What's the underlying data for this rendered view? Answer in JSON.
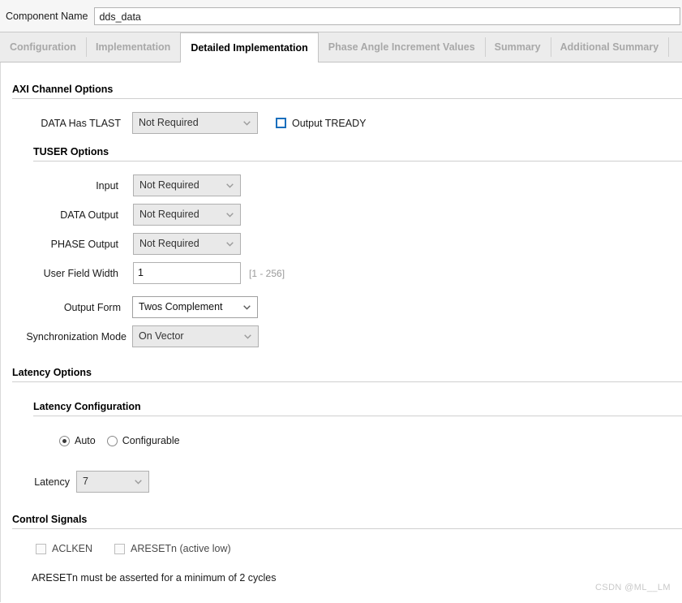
{
  "component": {
    "label": "Component Name",
    "value": "dds_data"
  },
  "tabs": [
    {
      "label": "Configuration",
      "active": false
    },
    {
      "label": "Implementation",
      "active": false
    },
    {
      "label": "Detailed Implementation",
      "active": true
    },
    {
      "label": "Phase Angle Increment Values",
      "active": false
    },
    {
      "label": "Summary",
      "active": false
    },
    {
      "label": "Additional Summary",
      "active": false
    }
  ],
  "sections": {
    "axi": {
      "title": "AXI Channel Options",
      "tlast": {
        "label": "DATA Has TLAST",
        "value": "Not Required"
      },
      "output_tready": {
        "label": "Output TREADY",
        "checked": false
      },
      "tuser": {
        "title": "TUSER Options",
        "input": {
          "label": "Input",
          "value": "Not Required"
        },
        "data_output": {
          "label": "DATA Output",
          "value": "Not Required"
        },
        "phase_output": {
          "label": "PHASE Output",
          "value": "Not Required"
        },
        "user_field_width": {
          "label": "User Field Width",
          "value": "1",
          "range_hint": "[1 - 256]"
        }
      },
      "output_form": {
        "label": "Output Form",
        "value": "Twos Complement"
      },
      "sync_mode": {
        "label": "Synchronization Mode",
        "value": "On Vector"
      }
    },
    "latency": {
      "title": "Latency Options",
      "config": {
        "title": "Latency Configuration",
        "auto_label": "Auto",
        "configurable_label": "Configurable",
        "selected": "Auto"
      },
      "latency": {
        "label": "Latency",
        "value": "7"
      }
    },
    "control": {
      "title": "Control Signals",
      "aclken": {
        "label": "ACLKEN",
        "checked": false
      },
      "aresetn": {
        "label": "ARESETn (active low)",
        "checked": false
      },
      "note": "ARESETn must be asserted for a minimum of 2 cycles"
    }
  },
  "watermark": "CSDN @ML__LM",
  "colors": {
    "accent": "#1a6fbd",
    "tab_inactive_text": "#a8a8a8",
    "panel_bg": "#ffffff",
    "chrome_bg": "#ececec"
  }
}
